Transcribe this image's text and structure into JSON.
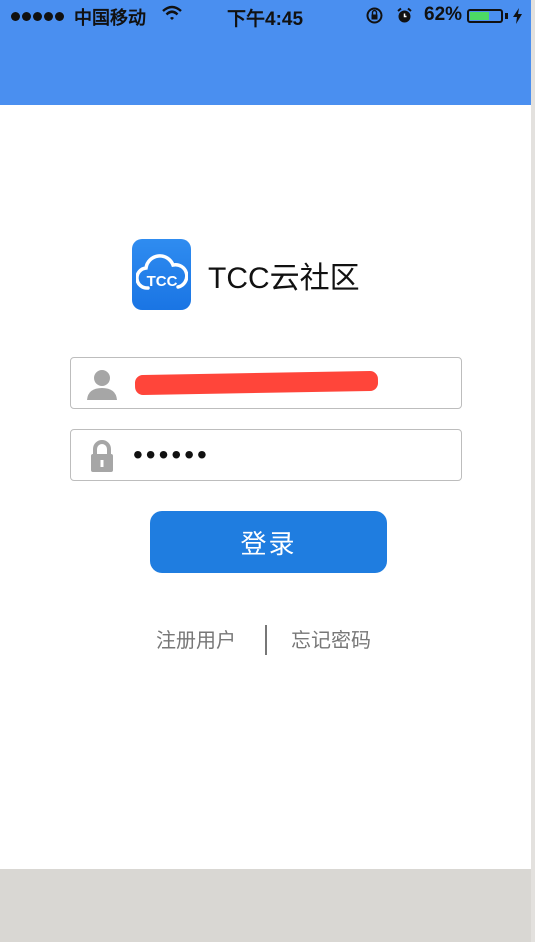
{
  "status_bar": {
    "carrier": "中国移动",
    "time": "下午4:45",
    "battery_percent": "62%",
    "battery_level": 0.62,
    "icons": [
      "signal-dots-icon",
      "wifi-icon",
      "rotation-lock-icon",
      "alarm-icon",
      "battery-icon",
      "charging-bolt-icon"
    ]
  },
  "app": {
    "name": "TCC云社区",
    "logo_text": "TCC"
  },
  "login_form": {
    "username_value": "",
    "password_value": "••••••",
    "username_icon": "user-icon",
    "password_icon": "lock-icon",
    "login_label": "登录"
  },
  "links": {
    "register": "注册用户",
    "forgot": "忘记密码"
  },
  "colors": {
    "header": "#4a8ff0",
    "primary_button": "#1f7de0",
    "logo": "#2f8cf0",
    "link_text": "#777777",
    "redaction": "#ff3b2f"
  }
}
